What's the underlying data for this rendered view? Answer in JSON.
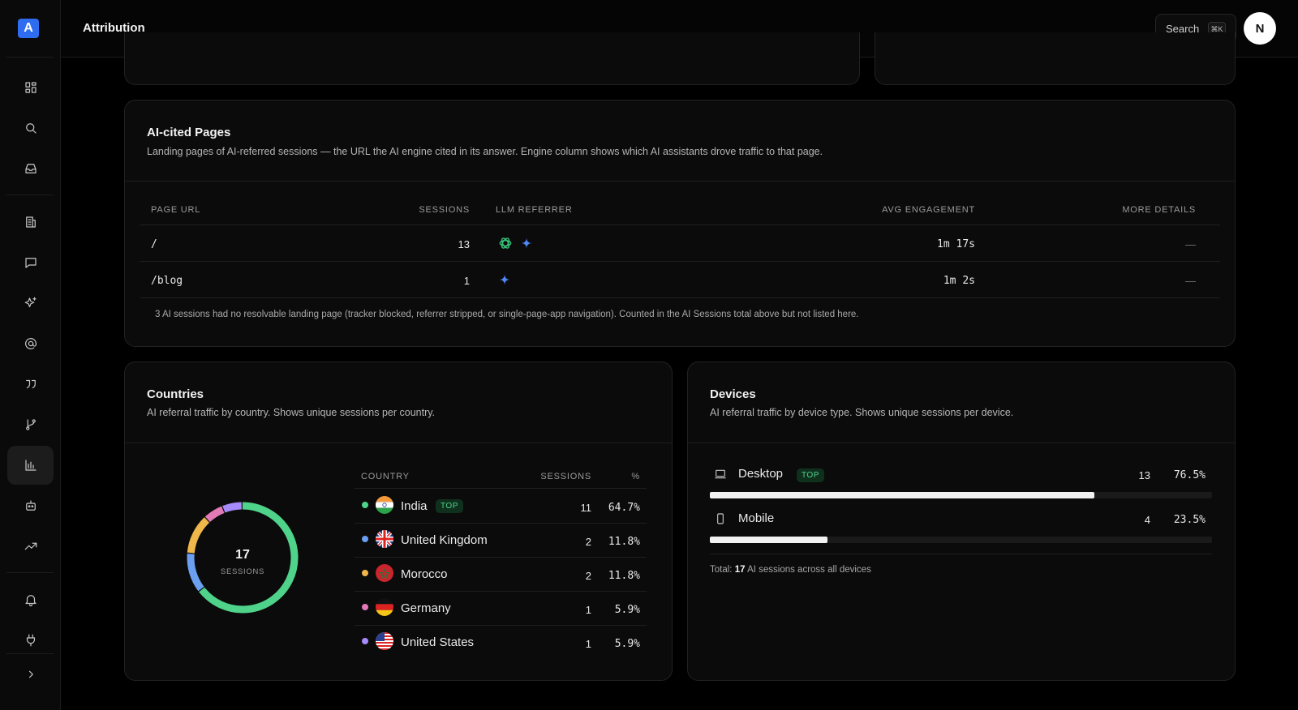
{
  "app": {
    "logo_text": "A",
    "page_title": "Attribution"
  },
  "search": {
    "label": "Search",
    "shortcut": "⌘K"
  },
  "user": {
    "avatar_initial": "N"
  },
  "sidebar": {
    "items": [
      {
        "icon": "dashboard-icon"
      },
      {
        "icon": "search-icon"
      },
      {
        "icon": "inbox-icon"
      },
      {
        "icon": "building-icon"
      },
      {
        "icon": "chat-icon"
      },
      {
        "icon": "sparkles-icon"
      },
      {
        "icon": "at-sign-icon"
      },
      {
        "icon": "quote-icon"
      },
      {
        "icon": "git-branch-icon"
      },
      {
        "icon": "bar-chart-icon",
        "active": true
      },
      {
        "icon": "bot-icon"
      },
      {
        "icon": "trending-up-icon"
      },
      {
        "icon": "bell-icon"
      },
      {
        "icon": "plug-icon"
      },
      {
        "icon": "chevron-right-icon"
      }
    ]
  },
  "cited_pages": {
    "title": "AI-cited Pages",
    "subtitle": "Landing pages of AI-referred sessions — the URL the AI engine cited in its answer. Engine column shows which AI assistants drove traffic to that page.",
    "columns": {
      "url": "PAGE URL",
      "sessions": "SESSIONS",
      "referrer": "LLM REFERRER",
      "engagement": "AVG ENGAGEMENT",
      "details": "MORE DETAILS"
    },
    "rows": [
      {
        "url": "/",
        "sessions": "13",
        "referrers": [
          "openai-icon",
          "gemini-icon"
        ],
        "engagement": "1m 17s",
        "details": "—"
      },
      {
        "url": "/blog",
        "sessions": "1",
        "referrers": [
          "gemini-icon"
        ],
        "engagement": "1m 2s",
        "details": "—"
      }
    ],
    "note": "3 AI sessions had no resolvable landing page (tracker blocked, referrer stripped, or single-page-app navigation). Counted in the AI Sessions total above but not listed here."
  },
  "countries": {
    "title": "Countries",
    "subtitle": "AI referral traffic by country. Shows unique sessions per country.",
    "total": "17",
    "total_label": "SESSIONS",
    "columns": {
      "country": "COUNTRY",
      "sessions": "SESSIONS",
      "pct": "%"
    },
    "top_badge": "TOP",
    "rows": [
      {
        "name": "India",
        "sessions": "11",
        "pct": "64.7%",
        "color": "#4fd38a",
        "flag": "india-flag-icon",
        "top": true
      },
      {
        "name": "United Kingdom",
        "sessions": "2",
        "pct": "11.8%",
        "color": "#6b9ff0",
        "flag": "uk-flag-icon"
      },
      {
        "name": "Morocco",
        "sessions": "2",
        "pct": "11.8%",
        "color": "#f0b84a",
        "flag": "morocco-flag-icon"
      },
      {
        "name": "Germany",
        "sessions": "1",
        "pct": "5.9%",
        "color": "#e27ab8",
        "flag": "germany-flag-icon"
      },
      {
        "name": "United States",
        "sessions": "1",
        "pct": "5.9%",
        "color": "#a78bfa",
        "flag": "us-flag-icon"
      }
    ]
  },
  "devices": {
    "title": "Devices",
    "subtitle": "AI referral traffic by device type. Shows unique sessions per device.",
    "top_badge": "TOP",
    "rows": [
      {
        "name": "Desktop",
        "sessions": "13",
        "pct": "76.5%",
        "share": 0.765,
        "icon": "laptop-icon",
        "top": true
      },
      {
        "name": "Mobile",
        "sessions": "4",
        "pct": "23.5%",
        "share": 0.235,
        "icon": "phone-icon"
      }
    ],
    "total_prefix": "Total:",
    "total_value": "17",
    "total_suffix": "AI sessions across all devices"
  }
}
